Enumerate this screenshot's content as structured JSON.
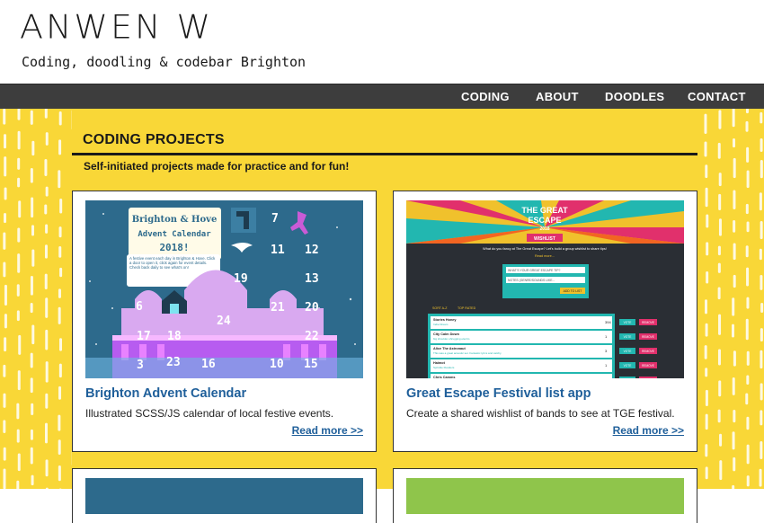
{
  "site": {
    "logo": "ANWEN W",
    "tagline": "Coding, doodling & codebar Brighton"
  },
  "nav": {
    "items": [
      {
        "label": "CODING"
      },
      {
        "label": "ABOUT"
      },
      {
        "label": "DOODLES"
      },
      {
        "label": "CONTACT"
      }
    ]
  },
  "colors": {
    "background_yellow": "#f9d737",
    "nav_bg": "#3d3d3d",
    "link_blue": "#1f5f9a"
  },
  "section": {
    "title": "CODING PROJECTS",
    "subtitle": "Self-initiated projects made for practice and for fun!"
  },
  "projects": [
    {
      "title": "Brighton Advent Calendar",
      "description": "Illustrated SCSS/JS calendar of local festive events.",
      "read_more": "Read more >>",
      "image": {
        "heading_line1": "Brighton & Hove",
        "heading_line2": "Advent Calendar",
        "heading_line3": "2018!",
        "intro": "A festive event each day in Brighton & Hove. Click a door to open it, click again for event details. Check back daily to see what's on!",
        "days": [
          "7",
          "11",
          "12",
          "19",
          "13",
          "21",
          "20",
          "6",
          "24",
          "17",
          "18",
          "22",
          "3",
          "23",
          "16",
          "10",
          "15"
        ]
      }
    },
    {
      "title": "Great Escape Festival list app",
      "description": "Create a shared wishlist of bands to see at TGE festival.",
      "read_more": "Read more >>",
      "image": {
        "banner_line1": "THE GREAT",
        "banner_line2": "ESCAPE",
        "banner_year": "2018",
        "badge": "WISHLIST",
        "question": "What do you fancy at The Great Escape? Let's build a group wishlist to share tips!",
        "read_more": "Read more...",
        "input1_placeholder": "WHAT'S YOUR GREAT ESCAPE TIP?",
        "input2_placeholder": "NOTES (GENRE/SOUNDS LIKE...",
        "add_button": "ADD TO LIST",
        "sort_label": "SORT A-Z",
        "top_rated_label": "TOP RATED",
        "rows": [
          {
            "name": "Stories Honey",
            "note": "Indie Dream",
            "votes": "394"
          },
          {
            "name": "City Calm Down",
            "note": "big shoulder-shrugging electro",
            "votes": "1"
          },
          {
            "name": "Alice The Astronaut",
            "note": "This was a great acoustic set. Fantastic lyrics and catchy.",
            "votes": "3"
          },
          {
            "name": "Haimot",
            "note": "Sprinkle Flanders",
            "votes": "1"
          },
          {
            "name": "Chris Camms",
            "note": "",
            "votes": "1"
          }
        ],
        "vote_label": "VOTE",
        "remove_label": "REMOVE"
      }
    }
  ]
}
